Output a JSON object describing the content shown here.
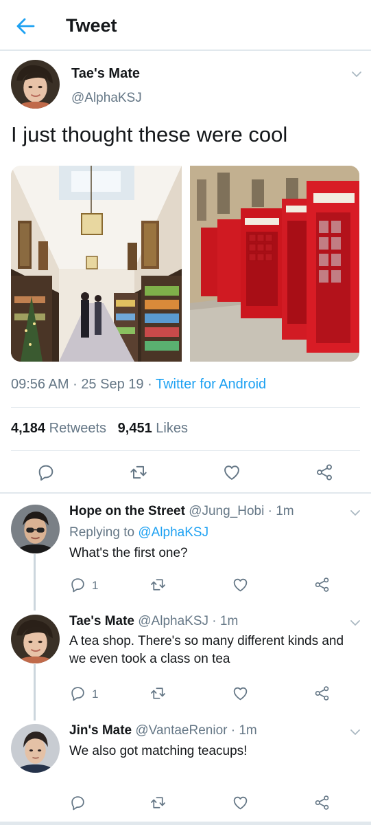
{
  "header": {
    "title": "Tweet"
  },
  "tweet": {
    "name": "Tae's Mate",
    "handle": "@AlphaKSJ",
    "text": "I just thought these were cool",
    "time": "09:56 AM",
    "date": "25 Sep 19",
    "source": "Twitter for Android",
    "retweet_count": "4,184",
    "retweet_label": "Retweets",
    "like_count": "9,451",
    "like_label": "Likes"
  },
  "replies": [
    {
      "name": "Hope on the Street",
      "handle": "@Jung_Hobi",
      "age": "1m",
      "replying_prefix": "Replying to",
      "replying_to": "@AlphaKSJ",
      "text": "What's the first one?",
      "reply_count": "1"
    },
    {
      "name": "Tae's Mate",
      "handle": "@AlphaKSJ",
      "age": "1m",
      "text": "A tea shop. There's so many different kinds and we even took a class on tea",
      "reply_count": "1"
    },
    {
      "name": "Jin's Mate",
      "handle": "@VantaeRenior",
      "age": "1m",
      "text": "We also got matching teacups!"
    }
  ],
  "separator": "·",
  "colors": {
    "accent": "#1da1f2",
    "secondary_text": "#657786",
    "border": "#e1e8ed"
  },
  "icons": [
    "back-arrow-icon",
    "chevron-down-icon",
    "reply-icon",
    "retweet-icon",
    "like-icon",
    "share-icon"
  ]
}
